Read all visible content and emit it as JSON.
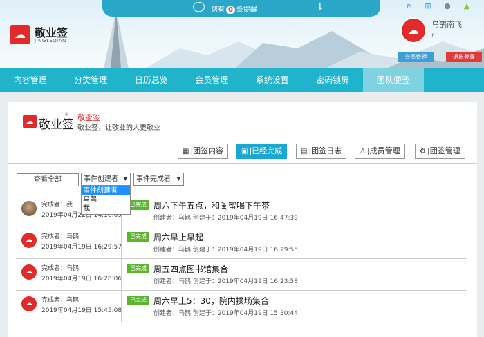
{
  "notification": {
    "prefix": "您有",
    "count": "0",
    "suffix": "条提醒"
  },
  "brand": {
    "name": "敬业签",
    "sub": "JINGYEQIAN"
  },
  "user": {
    "name": "乌鹊南飞",
    "id": "r"
  },
  "header_buttons": {
    "member": "会员管理",
    "logout": "退出登录"
  },
  "nav": {
    "items": [
      {
        "label": "内容管理"
      },
      {
        "label": "分类管理"
      },
      {
        "label": "日历总览"
      },
      {
        "label": "会员管理"
      },
      {
        "label": "系统设置"
      },
      {
        "label": "密码锁屏"
      },
      {
        "label": "团队便签"
      }
    ],
    "active_index": 6
  },
  "team": {
    "logo_text": "敬业签",
    "link": "敬业签",
    "desc": "敬业签，让敬业的人更敬业"
  },
  "tabs": [
    {
      "icon": "grid-icon",
      "label": "团签内容"
    },
    {
      "icon": "done-icon",
      "label": "已经完成"
    },
    {
      "icon": "log-icon",
      "label": "团签日志"
    },
    {
      "icon": "member-icon",
      "label": "成员管理"
    },
    {
      "icon": "gear-icon",
      "label": "团签管理"
    }
  ],
  "filters": {
    "view_all": "查看全部",
    "creator_select": "事件创建者",
    "finisher_select": "事件完成者",
    "creator_options": [
      "事件创建者",
      "乌鹊",
      "我"
    ]
  },
  "items": [
    {
      "who": "完成者：我",
      "when": "2019年04月22日 14:18:09",
      "badge": "已完成",
      "title": "周六下午五点，和闺蜜喝下午茶",
      "meta": "创建者：乌鹊   创建于：2019年04月19日 16:47:39"
    },
    {
      "who": "完成者：乌鹊",
      "when": "2019年04月19日 16:29:57",
      "badge": "已完成",
      "title": "周六早上早起",
      "meta": "创建者：乌鹊   创建于：2019年04月19日 16:29:55"
    },
    {
      "who": "完成者：乌鹊",
      "when": "2019年04月19日 16:28:06",
      "badge": "已完成",
      "title": "周五四点图书馆集合",
      "meta": "创建者：乌鹊   创建于：2019年04月19日 16:23:58"
    },
    {
      "who": "完成者：乌鹊",
      "when": "2019年04月19日 15:45:08",
      "badge": "已完成",
      "title": "周六早上5：30，院内操场集合",
      "meta": "创建者：乌鹊   创建于：2019年04月19日 15:30:44"
    }
  ]
}
